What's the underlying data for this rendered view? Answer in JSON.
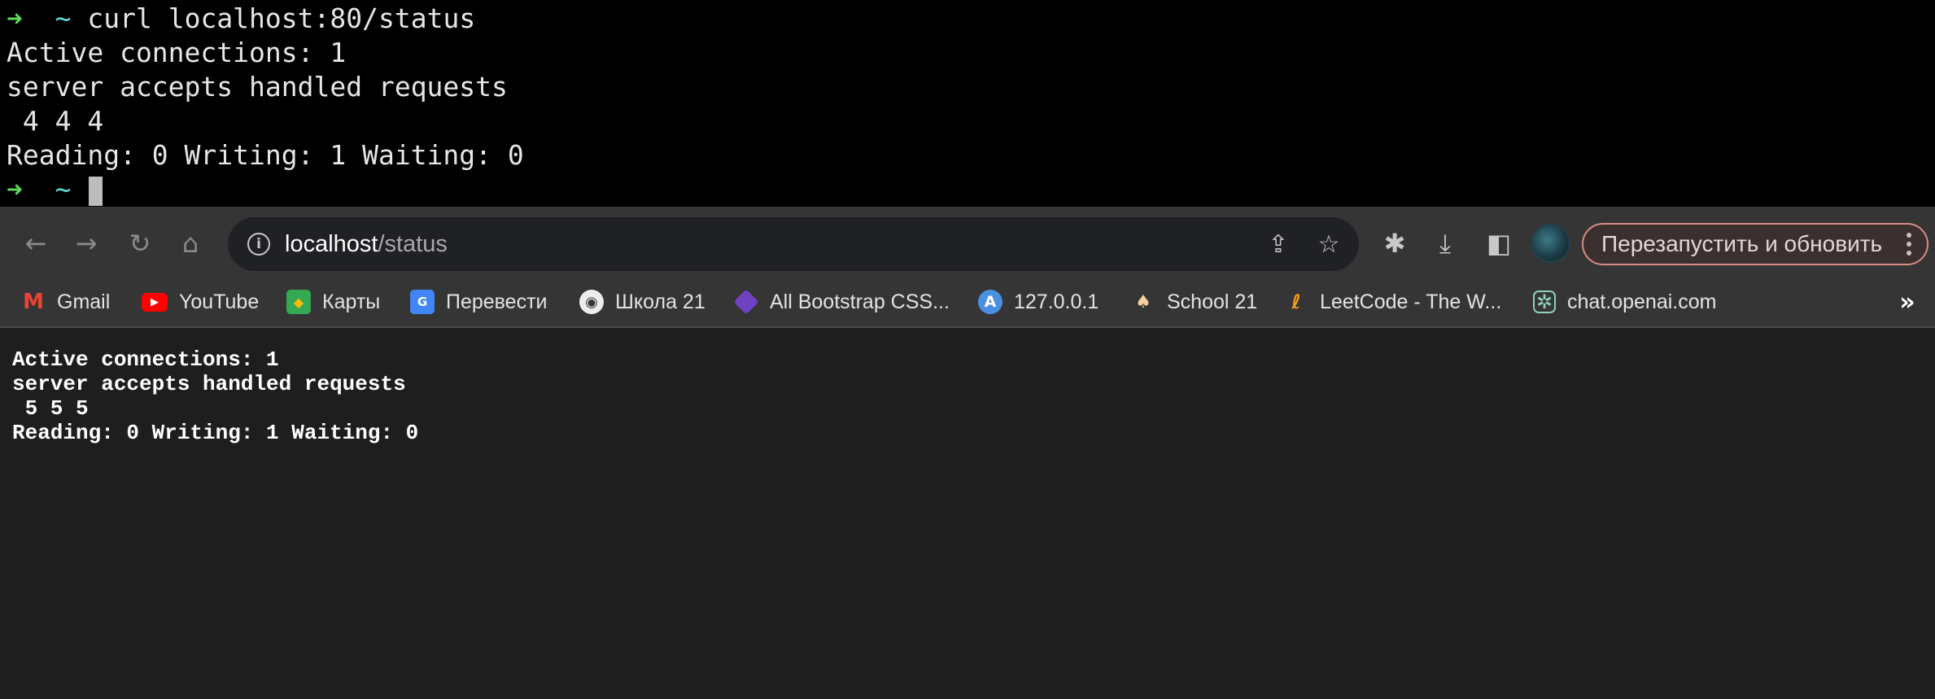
{
  "terminal": {
    "prompt_arrow": "➜",
    "prompt_dir": "~",
    "lines": [
      {
        "command": "curl localhost:80/status"
      },
      {
        "output": "Active connections: 1"
      },
      {
        "output": "server accepts handled requests"
      },
      {
        "output": " 4 4 4"
      },
      {
        "output": "Reading: 0 Writing: 1 Waiting: 0"
      }
    ],
    "command": "curl localhost:80/status"
  },
  "browser": {
    "url_host": "localhost",
    "url_path": "/status",
    "relaunch_label": "Перезапустить и обновить",
    "bookmarks": [
      {
        "label": "Gmail",
        "icon": "gmail-icon"
      },
      {
        "label": "YouTube",
        "icon": "youtube-icon"
      },
      {
        "label": "Карты",
        "icon": "maps-icon"
      },
      {
        "label": "Перевести",
        "icon": "translate-icon"
      },
      {
        "label": "Школа 21",
        "icon": "globe-icon"
      },
      {
        "label": "All Bootstrap CSS...",
        "icon": "bootstrap-icon"
      },
      {
        "label": "127.0.0.1",
        "icon": "letter-a-icon"
      },
      {
        "label": "School 21",
        "icon": "school-icon"
      },
      {
        "label": "LeetCode - The W...",
        "icon": "leetcode-icon"
      },
      {
        "label": "chat.openai.com",
        "icon": "openai-icon"
      }
    ],
    "overflow": "»"
  },
  "page": {
    "lines": [
      "Active connections: 1",
      "server accepts handled requests",
      " 5 5 5",
      "Reading: 0 Writing: 1 Waiting: 0"
    ]
  }
}
